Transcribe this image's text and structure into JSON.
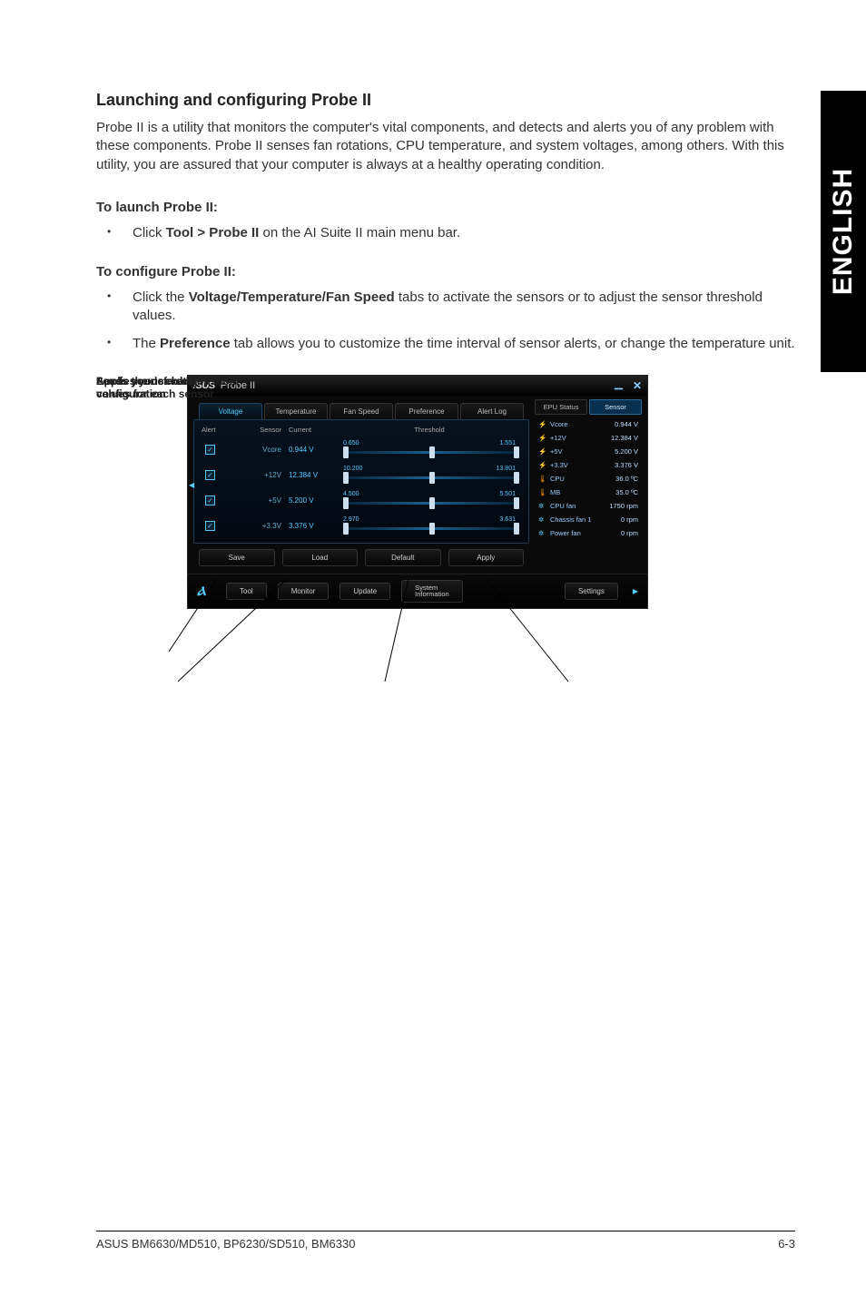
{
  "sideTab": "ENGLISH",
  "heading": "Launching and configuring Probe II",
  "intro": "Probe II is a utility that monitors the computer's vital components, and detects and alerts you of any problem with these components. Probe II senses fan rotations, CPU temperature, and system voltages, among others. With this utility, you are assured that your computer is always at a healthy operating condition.",
  "launchHead": "To launch Probe II:",
  "launchItem_pre": "Click ",
  "launchItem_bold": "Tool > Probe II",
  "launchItem_post": " on the AI Suite II main menu bar.",
  "configHead": "To configure Probe II:",
  "cfg1_pre": "Click the ",
  "cfg1_bold": "Voltage/Temperature/Fan Speed",
  "cfg1_post": " tabs to activate the sensors or to adjust the sensor threshold values.",
  "cfg2_pre": "The ",
  "cfg2_bold": "Preference",
  "cfg2_post": " tab allows you to customize the time interval of sensor alerts, or change the temperature unit.",
  "window": {
    "brand": "/SUS",
    "title": "Probe II",
    "tabs": [
      "Voltage",
      "Temperature",
      "Fan Speed",
      "Preference",
      "Alert Log"
    ],
    "cols": {
      "alert": "Alert",
      "sensor": "Sensor",
      "current": "Current",
      "threshold": "Threshold"
    },
    "rows": [
      {
        "name": "Vcore",
        "current": "0.944 V",
        "low": "0.650",
        "high": "1.551"
      },
      {
        "name": "+12V",
        "current": "12.384 V",
        "low": "10.200",
        "high": "13.801"
      },
      {
        "name": "+5V",
        "current": "5.200 V",
        "low": "4.500",
        "high": "5.501"
      },
      {
        "name": "+3.3V",
        "current": "3.376 V",
        "low": "2.970",
        "high": "3.631"
      }
    ],
    "buttons": {
      "save": "Save",
      "load": "Load",
      "default": "Default",
      "apply": "Apply"
    },
    "rightTabs": {
      "epu": "EPU Status",
      "sensor": "Sensor"
    },
    "stats": [
      {
        "icon": "bolt",
        "name": "Vcore",
        "value": "0.944 V"
      },
      {
        "icon": "bolt",
        "name": "+12V",
        "value": "12.384 V"
      },
      {
        "icon": "bolt",
        "name": "+5V",
        "value": "5.200 V"
      },
      {
        "icon": "bolt",
        "name": "+3.3V",
        "value": "3.376 V"
      },
      {
        "icon": "therm",
        "name": "CPU",
        "value": "36.0 ºC"
      },
      {
        "icon": "therm",
        "name": "MB",
        "value": "35.0 ºC"
      },
      {
        "icon": "fan",
        "name": "CPU fan",
        "value": "1750 rpm"
      },
      {
        "icon": "fan",
        "name": "Chassis fan 1",
        "value": "0 rpm"
      },
      {
        "icon": "fan",
        "name": "Power fan",
        "value": "0 rpm"
      }
    ],
    "bottom": {
      "tool": "Tool",
      "monitor": "Monitor",
      "update": "Update",
      "sysinfo": "System\nInformation",
      "settings": "Settings"
    }
  },
  "callouts": {
    "saves": "Saves your configuration",
    "loads": "Loads your saved configuration",
    "default": "Loads the default threshold values for each sensor",
    "apply": "Applies your changes"
  },
  "footer": {
    "left": "ASUS BM6630/MD510, BP6230/SD510, BM6330",
    "right": "6-3"
  }
}
